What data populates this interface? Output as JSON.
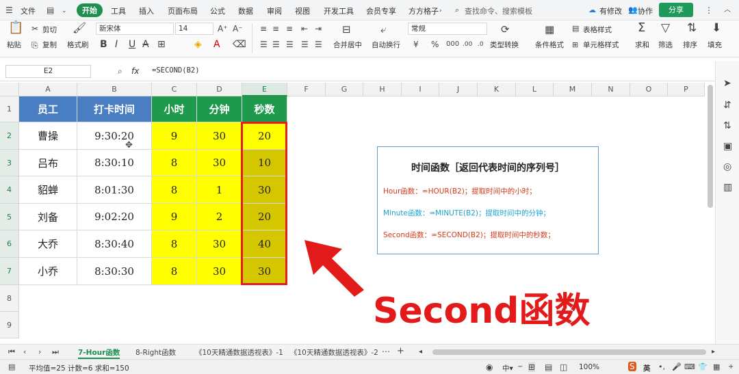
{
  "menubar": {
    "file": "文件",
    "tabs": [
      "开始",
      "工具",
      "插入",
      "页面布局",
      "公式",
      "数据",
      "审阅",
      "视图",
      "开发工具",
      "会员专享",
      "方方格子"
    ],
    "search_placeholder": "查找命令、搜索模板",
    "has_changes": "有修改",
    "collab": "协作",
    "share": "分享"
  },
  "ribbon": {
    "paste": "粘贴",
    "cut": "剪切",
    "copy": "复制",
    "format_painter": "格式刷",
    "font_name": "新宋体",
    "font_size": "14",
    "merge_center": "合并居中",
    "wrap": "自动换行",
    "number_format": "常规",
    "type_convert": "类型转换",
    "cond_format": "条件格式",
    "table_style": "表格样式",
    "cell_style": "单元格样式",
    "sum": "求和",
    "filter": "筛选",
    "sort": "排序",
    "fill": "填充"
  },
  "formula_bar": {
    "name_box": "E2",
    "fx": "fx",
    "formula": "=SECOND(B2)"
  },
  "columns": [
    "A",
    "B",
    "C",
    "D",
    "E",
    "F",
    "G",
    "H",
    "I",
    "J",
    "K",
    "L",
    "M",
    "N",
    "O",
    "P"
  ],
  "rows": [
    "1",
    "2",
    "3",
    "4",
    "5",
    "6",
    "7",
    "8",
    "9"
  ],
  "table": {
    "headers": [
      "员工",
      "打卡时间",
      "小时",
      "分钟",
      "秒数"
    ],
    "data": [
      [
        "曹操",
        "9:30:20",
        "9",
        "30",
        "20"
      ],
      [
        "吕布",
        "8:30:10",
        "8",
        "30",
        "10"
      ],
      [
        "貂蝉",
        "8:01:30",
        "8",
        "1",
        "30"
      ],
      [
        "刘备",
        "9:02:20",
        "9",
        "2",
        "20"
      ],
      [
        "大乔",
        "8:30:40",
        "8",
        "30",
        "40"
      ],
      [
        "小乔",
        "8:30:30",
        "8",
        "30",
        "30"
      ]
    ]
  },
  "info_box": {
    "title": "时间函数［返回代表时间的序列号］",
    "hour_line": "Hour函数：=HOUR(B2)；提取时间中的小时；",
    "minute_line": "Minute函数：=MINUTE(B2)；提取时间中的分钟；",
    "second_line": "Second函数：=SECOND(B2)；提取时间中的秒数；"
  },
  "overlay_title": "Second函数",
  "sheet_tabs": [
    "7-Hour函数",
    "8-Right函数",
    "《10天精通数据透视表》-1",
    "《10天精通数据透视表》-2"
  ],
  "status": {
    "summary": "平均值=25  计数=6  求和=150",
    "zoom": "100%",
    "ime": "英"
  },
  "colors": {
    "header_blue": "#4a7ec2",
    "header_green": "#1f9a4c",
    "cell_yellow": "#ffff00",
    "cell_olive": "#d4c700",
    "highlight_red": "#e02020",
    "accent_green": "#1e8f4f"
  }
}
